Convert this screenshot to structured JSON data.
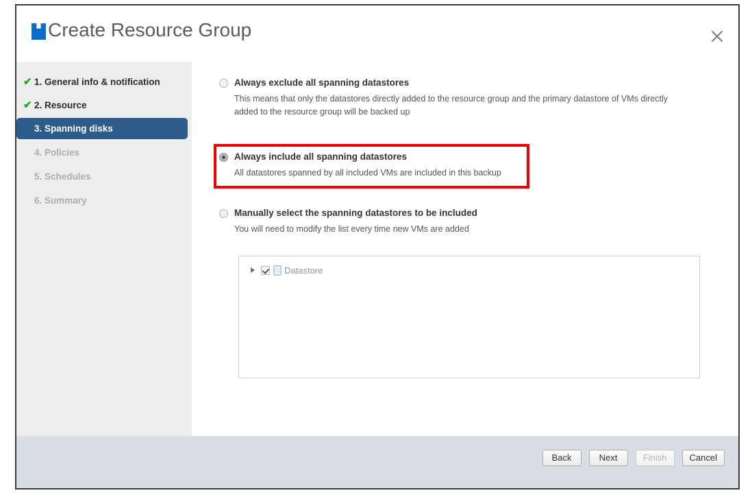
{
  "window": {
    "title": "Create Resource Group",
    "brand_icon": "netapp-logo-icon",
    "close_icon": "close-icon",
    "accent_color": "#0a6ec6",
    "active_step_color": "#2e5c8a",
    "highlight_color": "#ee0000"
  },
  "sidebar": {
    "items": [
      {
        "label": "1. General info & notification",
        "state": "done",
        "check": "✔"
      },
      {
        "label": "2. Resource",
        "state": "done",
        "check": "✔"
      },
      {
        "label": "3. Spanning disks",
        "state": "active",
        "check": ""
      },
      {
        "label": "4. Policies",
        "state": "pending",
        "check": ""
      },
      {
        "label": "5. Schedules",
        "state": "pending",
        "check": ""
      },
      {
        "label": "6. Summary",
        "state": "pending",
        "check": ""
      }
    ]
  },
  "main": {
    "options": [
      {
        "title": "Always exclude all spanning datastores",
        "description": "This means that only the datastores directly added to the resource group and the primary datastore of VMs directly added to the resource group will be backed up",
        "selected": false
      },
      {
        "title": "Always include all spanning datastores",
        "description": "All datastores spanned by all included VMs are included in this backup",
        "selected": true
      },
      {
        "title": "Manually select the spanning datastores to be included",
        "description": "You will need to modify the list every time new VMs are added",
        "selected": false
      }
    ],
    "tree": {
      "rows": [
        {
          "label": "Datastore",
          "checked": true,
          "expanded": false,
          "icon": "datastore-icon"
        }
      ]
    }
  },
  "footer": {
    "buttons": [
      {
        "label": "Back",
        "disabled": false
      },
      {
        "label": "Next",
        "disabled": false
      },
      {
        "label": "Finish",
        "disabled": true
      },
      {
        "label": "Cancel",
        "disabled": false
      }
    ]
  }
}
